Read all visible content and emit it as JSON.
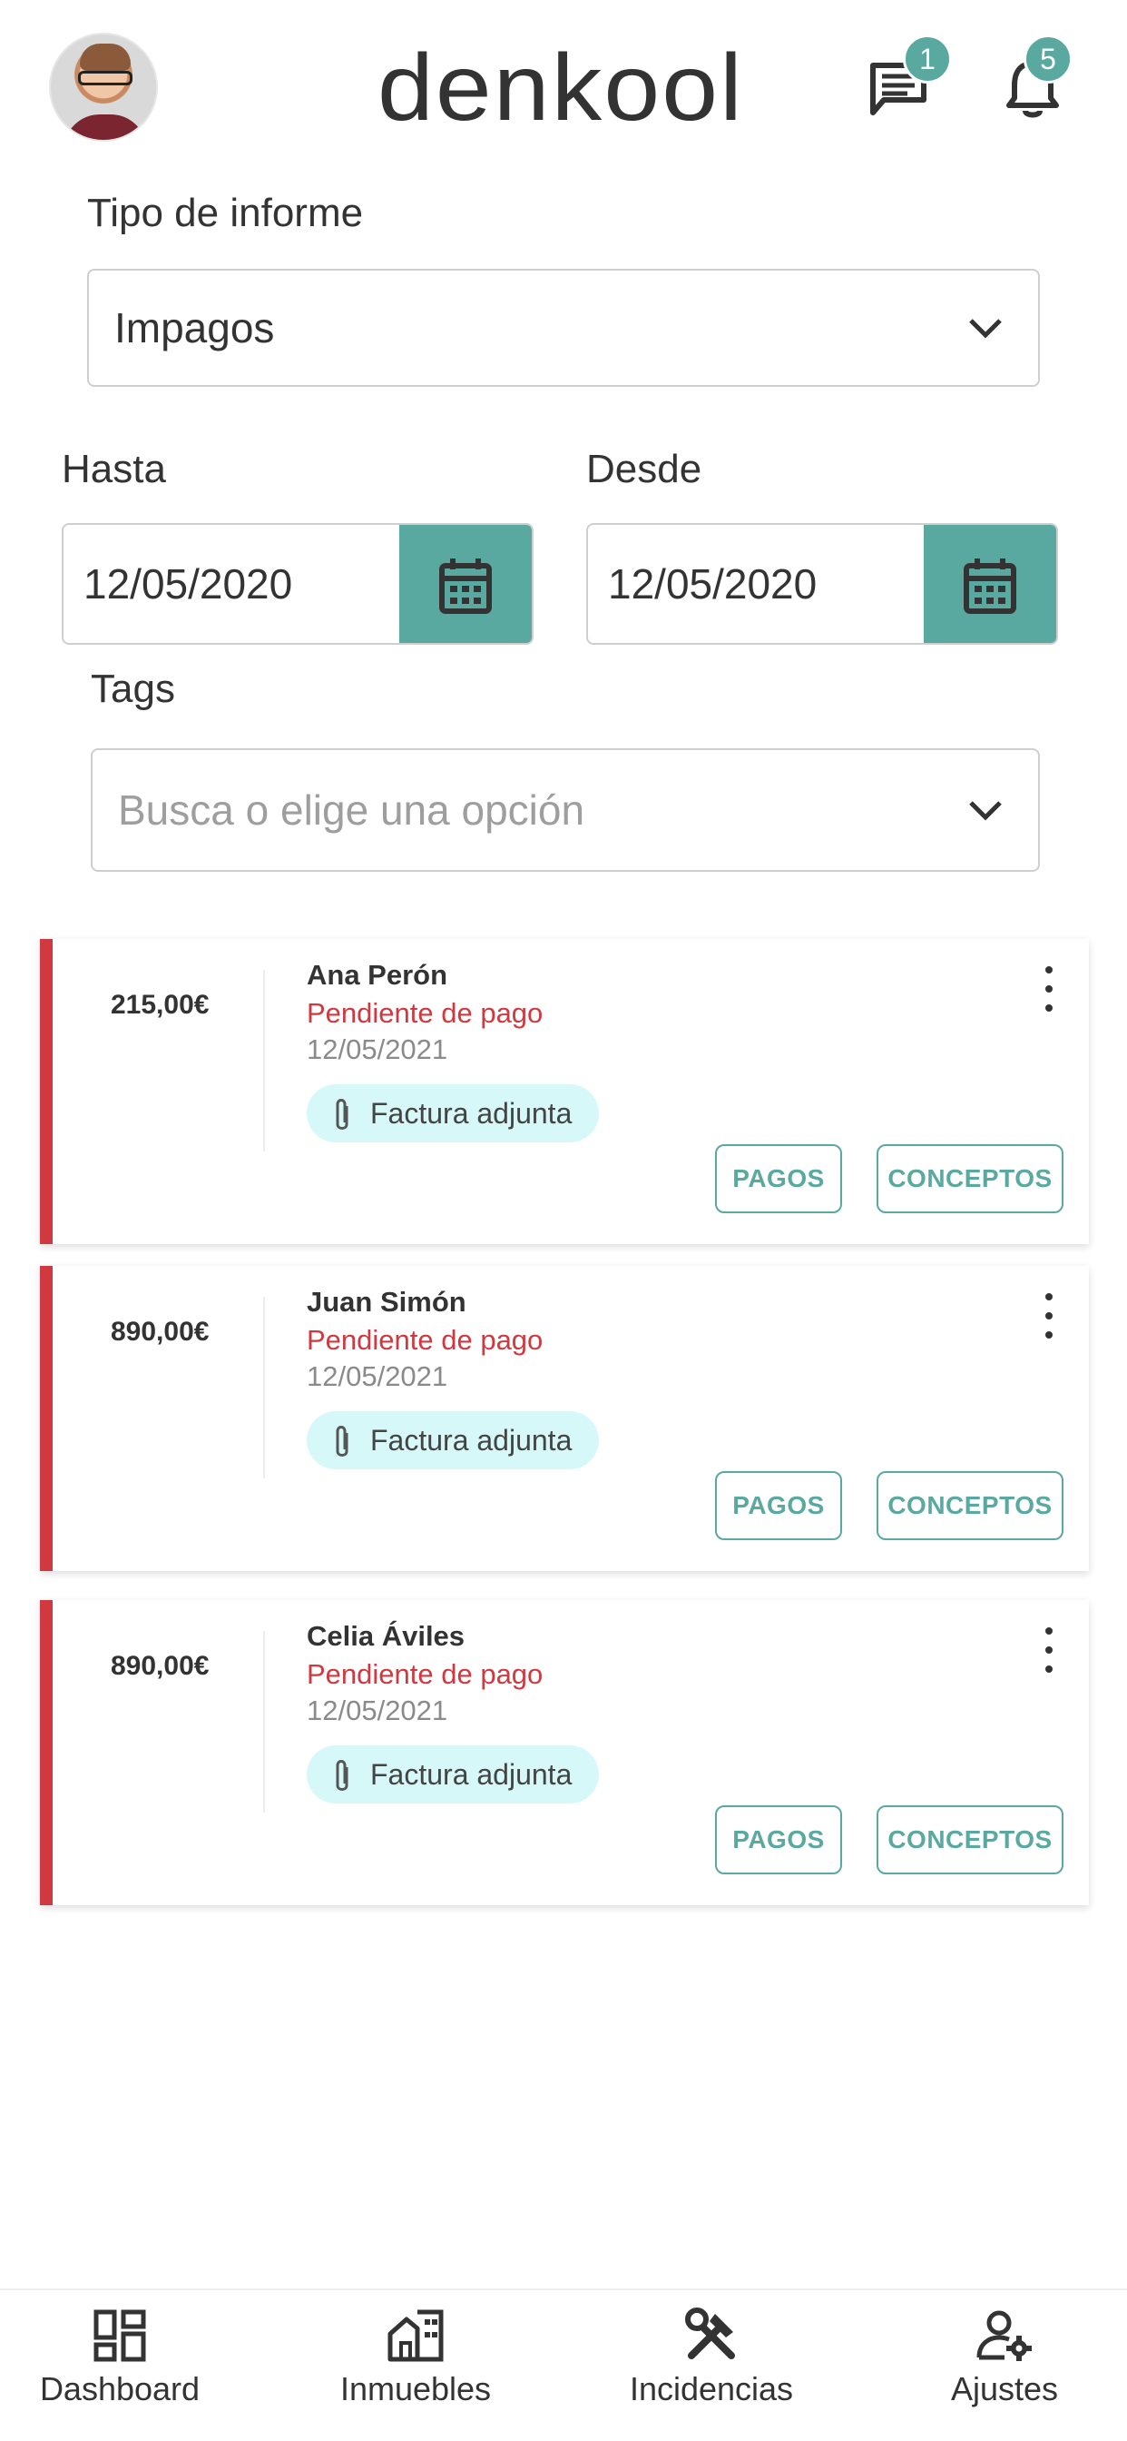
{
  "header": {
    "logo_text": "denkool",
    "chat_count": "1",
    "notification_count": "5",
    "accent": "#5aa9a0"
  },
  "filters": {
    "report_type_label": "Tipo de informe",
    "report_type_value": "Impagos",
    "until_label": "Hasta",
    "until_value": "12/05/2020",
    "from_label": "Desde",
    "from_value": "12/05/2020",
    "tags_label": "Tags",
    "tags_placeholder": "Busca o elige una opción"
  },
  "cards": [
    {
      "amount": "215,00€",
      "name": "Ana Perón",
      "status": "Pendiente de pago",
      "date": "12/05/2021",
      "chip": "Factura adjunta",
      "btn_pagos": "PAGOS",
      "btn_conceptos": "CONCEPTOS"
    },
    {
      "amount": "890,00€",
      "name": "Juan Simón",
      "status": "Pendiente de pago",
      "date": "12/05/2021",
      "chip": "Factura adjunta",
      "btn_pagos": "PAGOS",
      "btn_conceptos": "CONCEPTOS"
    },
    {
      "amount": "890,00€",
      "name": "Celia Áviles",
      "status": "Pendiente de pago",
      "date": "12/05/2021",
      "chip": "Factura adjunta",
      "btn_pagos": "PAGOS",
      "btn_conceptos": "CONCEPTOS"
    }
  ],
  "status_color": "#d0393f",
  "chip_color": "#d6f8f8",
  "bottom_nav": [
    {
      "label": "Dashboard",
      "icon": "dashboard-icon"
    },
    {
      "label": "Inmuebles",
      "icon": "building-icon"
    },
    {
      "label": "Incidencias",
      "icon": "tools-icon"
    },
    {
      "label": "Ajustes",
      "icon": "user-settings-icon"
    }
  ]
}
